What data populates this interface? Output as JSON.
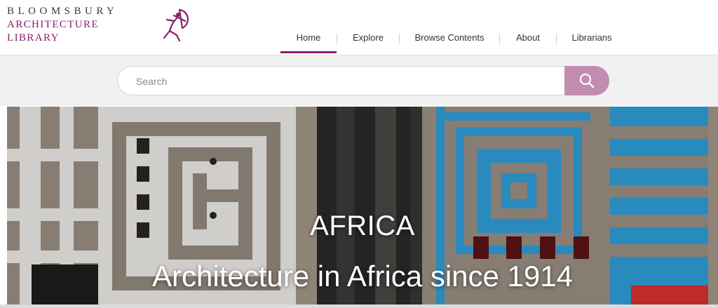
{
  "brand": {
    "line1": "BLOOMSBURY",
    "line2": "ARCHITECTURE",
    "line3": "LIBRARY",
    "accent_color": "#8a1e6b",
    "logo_icon": "archer-logo-icon"
  },
  "nav": {
    "items": [
      {
        "label": "Home",
        "active": true
      },
      {
        "label": "Explore",
        "active": false
      },
      {
        "label": "Browse Contents",
        "active": false
      },
      {
        "label": "About",
        "active": false
      },
      {
        "label": "Librarians",
        "active": false
      }
    ]
  },
  "search": {
    "placeholder": "Search",
    "value": "",
    "button_icon": "search-icon",
    "button_color": "#c28bb0"
  },
  "hero": {
    "title": "AFRICA",
    "subtitle": "Architecture in Africa since 1914"
  }
}
